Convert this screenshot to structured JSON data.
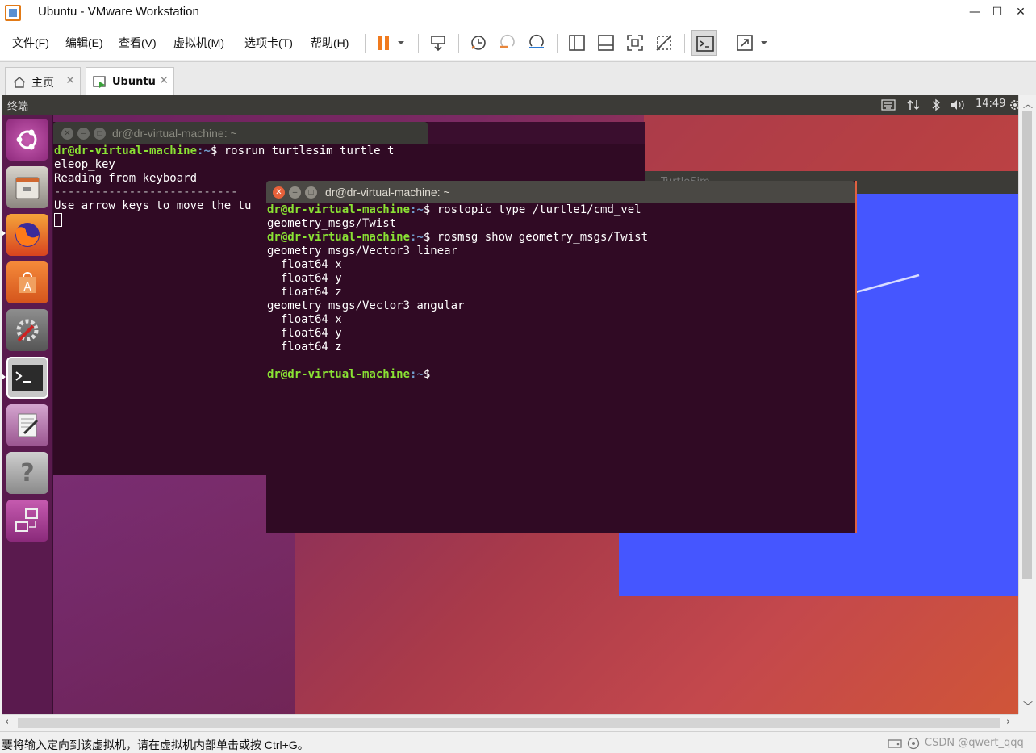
{
  "window": {
    "title": "Ubuntu - VMware Workstation",
    "controls": {
      "minimize": "—",
      "maximize": "☐",
      "close": "✕"
    }
  },
  "menubar": {
    "items": [
      "文件(F)",
      "编辑(E)",
      "查看(V)",
      "虚拟机(M)",
      "选项卡(T)",
      "帮助(H)"
    ]
  },
  "tabs": [
    {
      "label": "主页",
      "icon": "home-icon"
    },
    {
      "label": "Ubuntu",
      "icon": "vm-icon",
      "active": true
    }
  ],
  "guest": {
    "topbar": {
      "app_name": "终端",
      "time": "14:49",
      "tray_icons": [
        "keyboard-icon",
        "network-icon",
        "bluetooth-icon",
        "volume-icon",
        "gear-icon"
      ]
    },
    "launcher": [
      "ubuntu-dash-icon",
      "files-icon",
      "firefox-icon",
      "software-center-icon",
      "system-settings-icon",
      "terminal-icon",
      "text-editor-icon",
      "help-icon",
      "workspace-switcher-icon"
    ],
    "terminal_back": {
      "title": "dr@dr-virtual-machine: ~",
      "lines": [
        {
          "user": "dr@dr-virtual-machine",
          "path": ":~",
          "cmd": "$ rosrun turtlesim turtle_t"
        },
        {
          "text": "eleop_key"
        },
        {
          "text": "Reading from keyboard"
        },
        {
          "text": "---------------------------"
        },
        {
          "text": "Use arrow keys to move the tu"
        }
      ]
    },
    "terminal_front": {
      "title": "dr@dr-virtual-machine: ~",
      "lines": [
        {
          "user": "dr@dr-virtual-machine",
          "path": ":~",
          "cmd": "$ rostopic type /turtle1/cmd_vel"
        },
        {
          "text": "geometry_msgs/Twist"
        },
        {
          "user": "dr@dr-virtual-machine",
          "path": ":~",
          "cmd": "$ rosmsg show geometry_msgs/Twist"
        },
        {
          "text": "geometry_msgs/Vector3 linear"
        },
        {
          "text": "  float64 x"
        },
        {
          "text": "  float64 y"
        },
        {
          "text": "  float64 z"
        },
        {
          "text": "geometry_msgs/Vector3 angular"
        },
        {
          "text": "  float64 x"
        },
        {
          "text": "  float64 y"
        },
        {
          "text": "  float64 z"
        },
        {
          "text": ""
        },
        {
          "user": "dr@dr-virtual-machine",
          "path": ":~",
          "cmd": "$ "
        }
      ]
    },
    "turtlesim_title": "TurtleSim",
    "colors": {
      "turtlesim_bg": "#4556ff",
      "terminal_bg": "#300a24",
      "prompt_user": "#8ae234",
      "prompt_path": "#729fcf"
    }
  },
  "statusbar": {
    "message": "要将输入定向到该虚拟机，请在虚拟机内部单击或按 Ctrl+G。",
    "watermark": "CSDN @qwert_qqq"
  }
}
